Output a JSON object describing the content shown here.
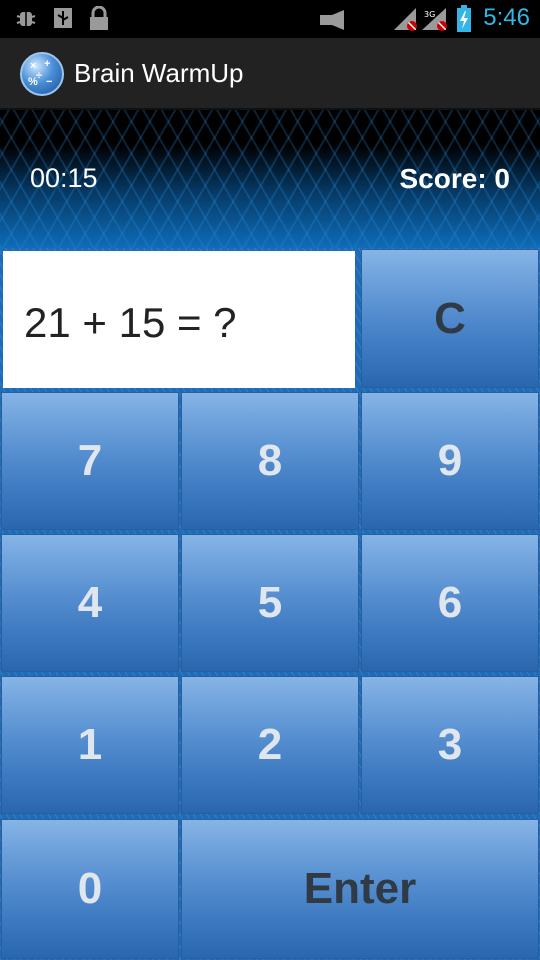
{
  "status_bar": {
    "time": "5:46",
    "icons": [
      "bug-icon",
      "usb-icon",
      "lock-icon",
      "media-icon",
      "signal-no-icon",
      "signal-3g-icon",
      "battery-charging-icon"
    ]
  },
  "action_bar": {
    "title": "Brain WarmUp",
    "icon": "app-logo-icon"
  },
  "game": {
    "timer": "00:15",
    "score": "Score: 0",
    "question": "21 + 15  = ?"
  },
  "keypad": {
    "clear": "C",
    "k7": "7",
    "k8": "8",
    "k9": "9",
    "k4": "4",
    "k5": "5",
    "k6": "6",
    "k1": "1",
    "k2": "2",
    "k3": "3",
    "k0": "0",
    "enter": "Enter"
  }
}
